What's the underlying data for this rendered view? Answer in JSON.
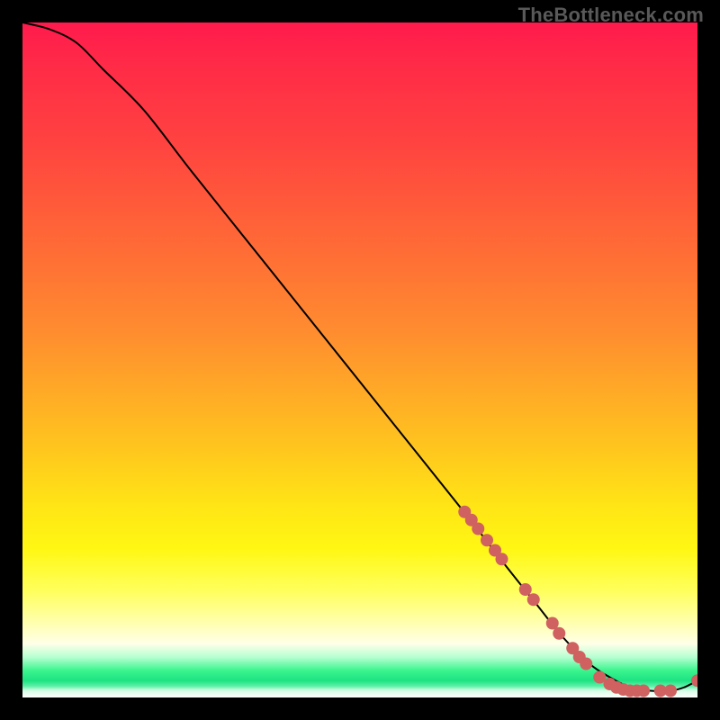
{
  "watermark": "TheBottleneck.com",
  "colors": {
    "curve": "#000000",
    "dot": "#cf6161",
    "background_top": "#ff1a4d",
    "background_bottom": "#ffffff",
    "green_band": "#1de383"
  },
  "chart_data": {
    "type": "line",
    "title": "",
    "xlabel": "",
    "ylabel": "",
    "xlim": [
      0,
      100
    ],
    "ylim": [
      0,
      100
    ],
    "note": "Axes unlabeled in source; values are normalized percent estimates from pixel positions.",
    "series": [
      {
        "name": "curve",
        "x": [
          0,
          4,
          8,
          12,
          18,
          25,
          35,
          45,
          55,
          65,
          72,
          76,
          80,
          84,
          87,
          90,
          93,
          96,
          98,
          100
        ],
        "y": [
          100,
          99,
          97,
          93,
          87,
          78,
          65.5,
          53,
          40.5,
          28,
          19,
          14,
          9,
          5,
          3,
          1.5,
          1,
          1,
          1.5,
          2.5
        ]
      }
    ],
    "points": [
      {
        "name": "cluster-a",
        "x": 65.5,
        "y": 27.5
      },
      {
        "name": "cluster-a",
        "x": 66.5,
        "y": 26.3
      },
      {
        "name": "cluster-a",
        "x": 67.5,
        "y": 25.0
      },
      {
        "name": "cluster-a",
        "x": 68.8,
        "y": 23.3
      },
      {
        "name": "cluster-a",
        "x": 70.0,
        "y": 21.8
      },
      {
        "name": "cluster-a",
        "x": 71.0,
        "y": 20.5
      },
      {
        "name": "cluster-b",
        "x": 74.5,
        "y": 16.0
      },
      {
        "name": "cluster-b",
        "x": 75.7,
        "y": 14.5
      },
      {
        "name": "cluster-c",
        "x": 78.5,
        "y": 11.0
      },
      {
        "name": "cluster-c",
        "x": 79.5,
        "y": 9.5
      },
      {
        "name": "cluster-d",
        "x": 81.5,
        "y": 7.3
      },
      {
        "name": "cluster-d",
        "x": 82.5,
        "y": 6.0
      },
      {
        "name": "cluster-d",
        "x": 83.5,
        "y": 5.0
      },
      {
        "name": "bottom",
        "x": 85.5,
        "y": 3.0
      },
      {
        "name": "bottom",
        "x": 87.0,
        "y": 2.0
      },
      {
        "name": "bottom",
        "x": 88.0,
        "y": 1.5
      },
      {
        "name": "bottom",
        "x": 89.0,
        "y": 1.2
      },
      {
        "name": "bottom",
        "x": 90.0,
        "y": 1.0
      },
      {
        "name": "bottom",
        "x": 91.0,
        "y": 1.0
      },
      {
        "name": "bottom",
        "x": 92.0,
        "y": 1.0
      },
      {
        "name": "bottom-gap",
        "x": 94.5,
        "y": 1.0
      },
      {
        "name": "bottom-gap",
        "x": 96.0,
        "y": 1.0
      },
      {
        "name": "end",
        "x": 100.0,
        "y": 2.5
      }
    ],
    "dot_radius_px": 7
  }
}
